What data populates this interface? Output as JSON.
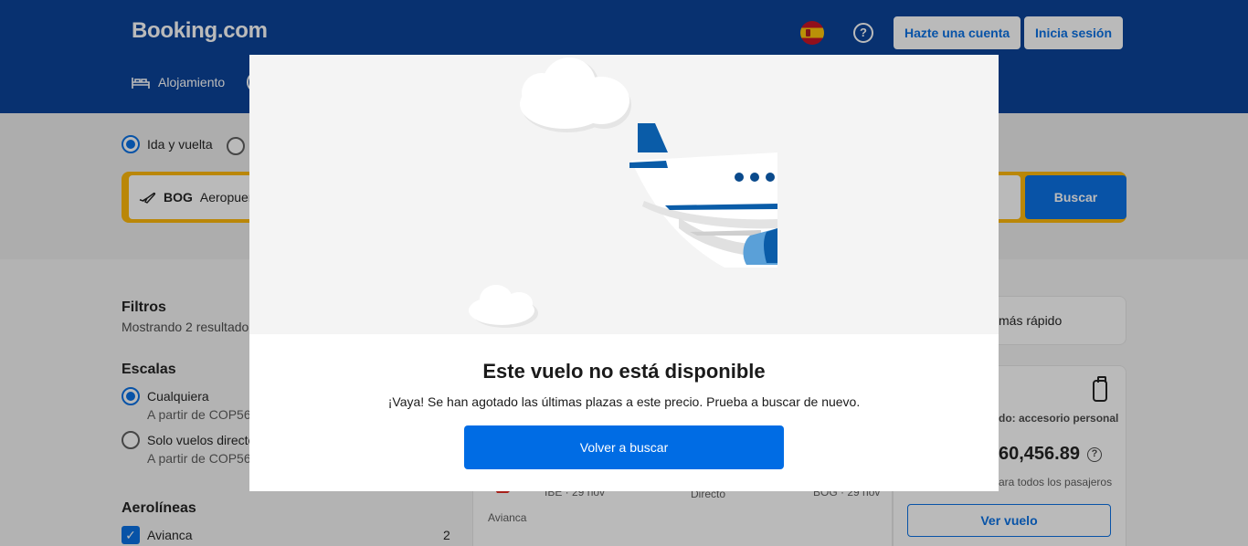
{
  "header": {
    "logo": "Booking.com",
    "register_label": "Hazte una cuenta",
    "login_label": "Inicia sesión",
    "nav_stays_label": "Alojamiento"
  },
  "search": {
    "trip_round_label": "Ida y vuelta",
    "origin_code": "BOG",
    "origin_text": "Aeropuerto",
    "search_label": "Buscar"
  },
  "filters": {
    "title": "Filtros",
    "subtitle": "Mostrando 2 resultado",
    "stops_title": "Escalas",
    "stops_any_label": "Cualquiera",
    "stops_any_sub": "A partir de COP56",
    "stops_direct_label": "Solo vuelos directo",
    "stops_direct_sub": "A partir de COP56",
    "airlines_title": "Aerolíneas",
    "airline_avianca_label": "Avianca",
    "airline_avianca_count": "2"
  },
  "result": {
    "left_route": "IBE · 29 nov",
    "stops": "Directo",
    "right_route": "BOG · 29 nov",
    "airline": "Avianca"
  },
  "sidebar": {
    "fastest_label": "más rápido",
    "bag_label": "do: accesorio personal",
    "price": "60,456.89",
    "price_sub": "ara todos los pasajeros",
    "view_label": "Ver vuelo"
  },
  "modal": {
    "title": "Este vuelo no está disponible",
    "message": "¡Vaya! Se han agotado las últimas plazas a este precio. Prueba a buscar de nuevo.",
    "button_label": "Volver a buscar"
  },
  "icons": {
    "flag": "spain-flag-icon",
    "help": "help-icon",
    "bed": "bed-icon",
    "plane": "plane-icon",
    "bag": "personal-item-icon"
  },
  "colors": {
    "brand": "#003b95",
    "accent": "#006ce4",
    "search_border": "#ffb700"
  }
}
